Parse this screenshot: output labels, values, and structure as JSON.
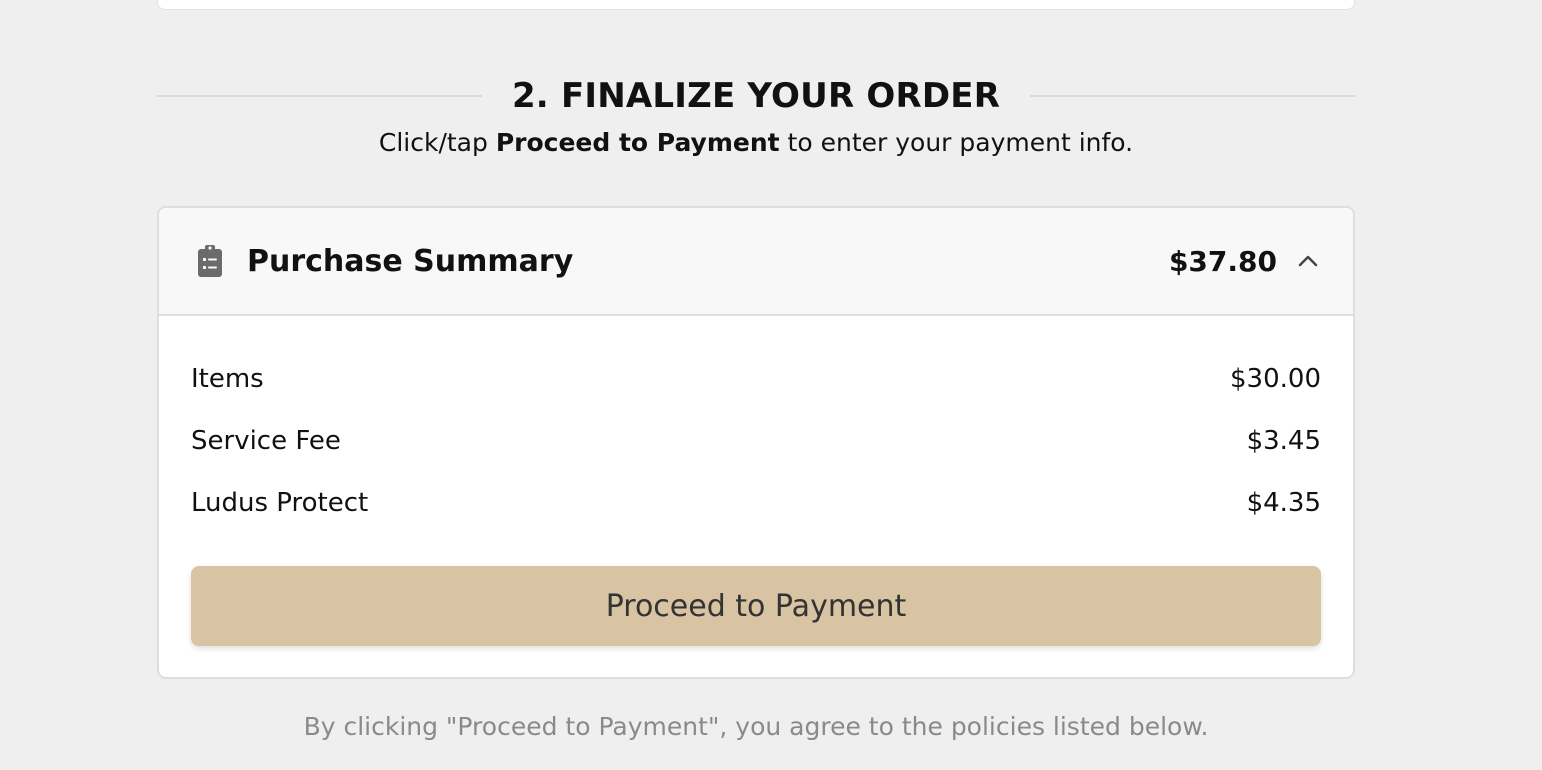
{
  "heading": {
    "title": "2. FINALIZE YOUR ORDER",
    "instruction_prefix": "Click/tap ",
    "instruction_bold": "Proceed to Payment",
    "instruction_suffix": " to enter your payment info."
  },
  "summary": {
    "icon": "clipboard-list-icon",
    "title": "Purchase Summary",
    "total": "$37.80",
    "toggle_icon": "chevron-up-icon",
    "items": [
      {
        "label": "Items",
        "amount": "$30.00"
      },
      {
        "label": "Service Fee",
        "amount": "$3.45"
      },
      {
        "label": "Ludus Protect",
        "amount": "$4.35"
      }
    ],
    "button_label": "Proceed to Payment"
  },
  "disclaimer": "By clicking \"Proceed to Payment\", you agree to the policies listed below.",
  "colors": {
    "background": "#efefef",
    "button": "#d8c3a2",
    "header_background": "#f8f8f8",
    "muted_text": "#8a8a8a"
  }
}
